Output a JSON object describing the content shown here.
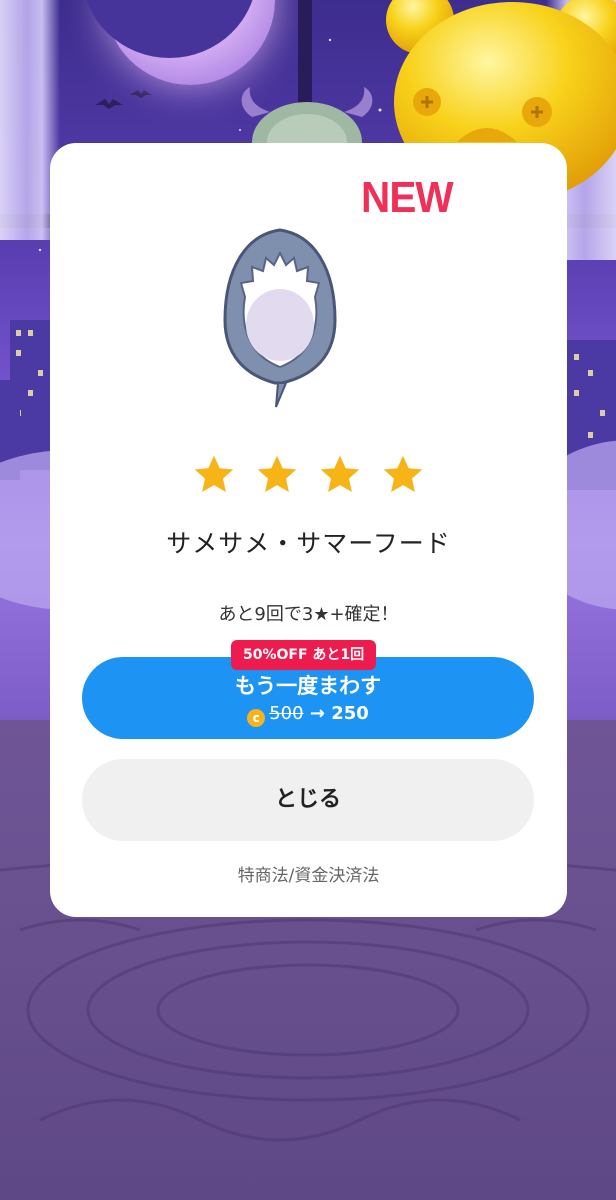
{
  "modal": {
    "new_label": "NEW",
    "item_name": "サメサメ・サマーフード",
    "rarity_stars": 4,
    "pity_text": "あと9回で3★+確定！",
    "discount_badge": "50%OFF あと1回",
    "spin_button": {
      "label": "もう一度まわす",
      "old_price": "500",
      "arrow": "→",
      "new_price": "250"
    },
    "close_button": "とじる",
    "legal_link": "特商法/資金決済法"
  },
  "colors": {
    "primary_button": "#1d94f4",
    "close_button": "#f0f0f0",
    "badge": "#ed1b4e",
    "new_label": "#f1305a",
    "star": "#f7b417",
    "coin": "#f5b41d"
  },
  "icons": [
    "star-icon",
    "coin-icon",
    "shark-hood-icon"
  ]
}
